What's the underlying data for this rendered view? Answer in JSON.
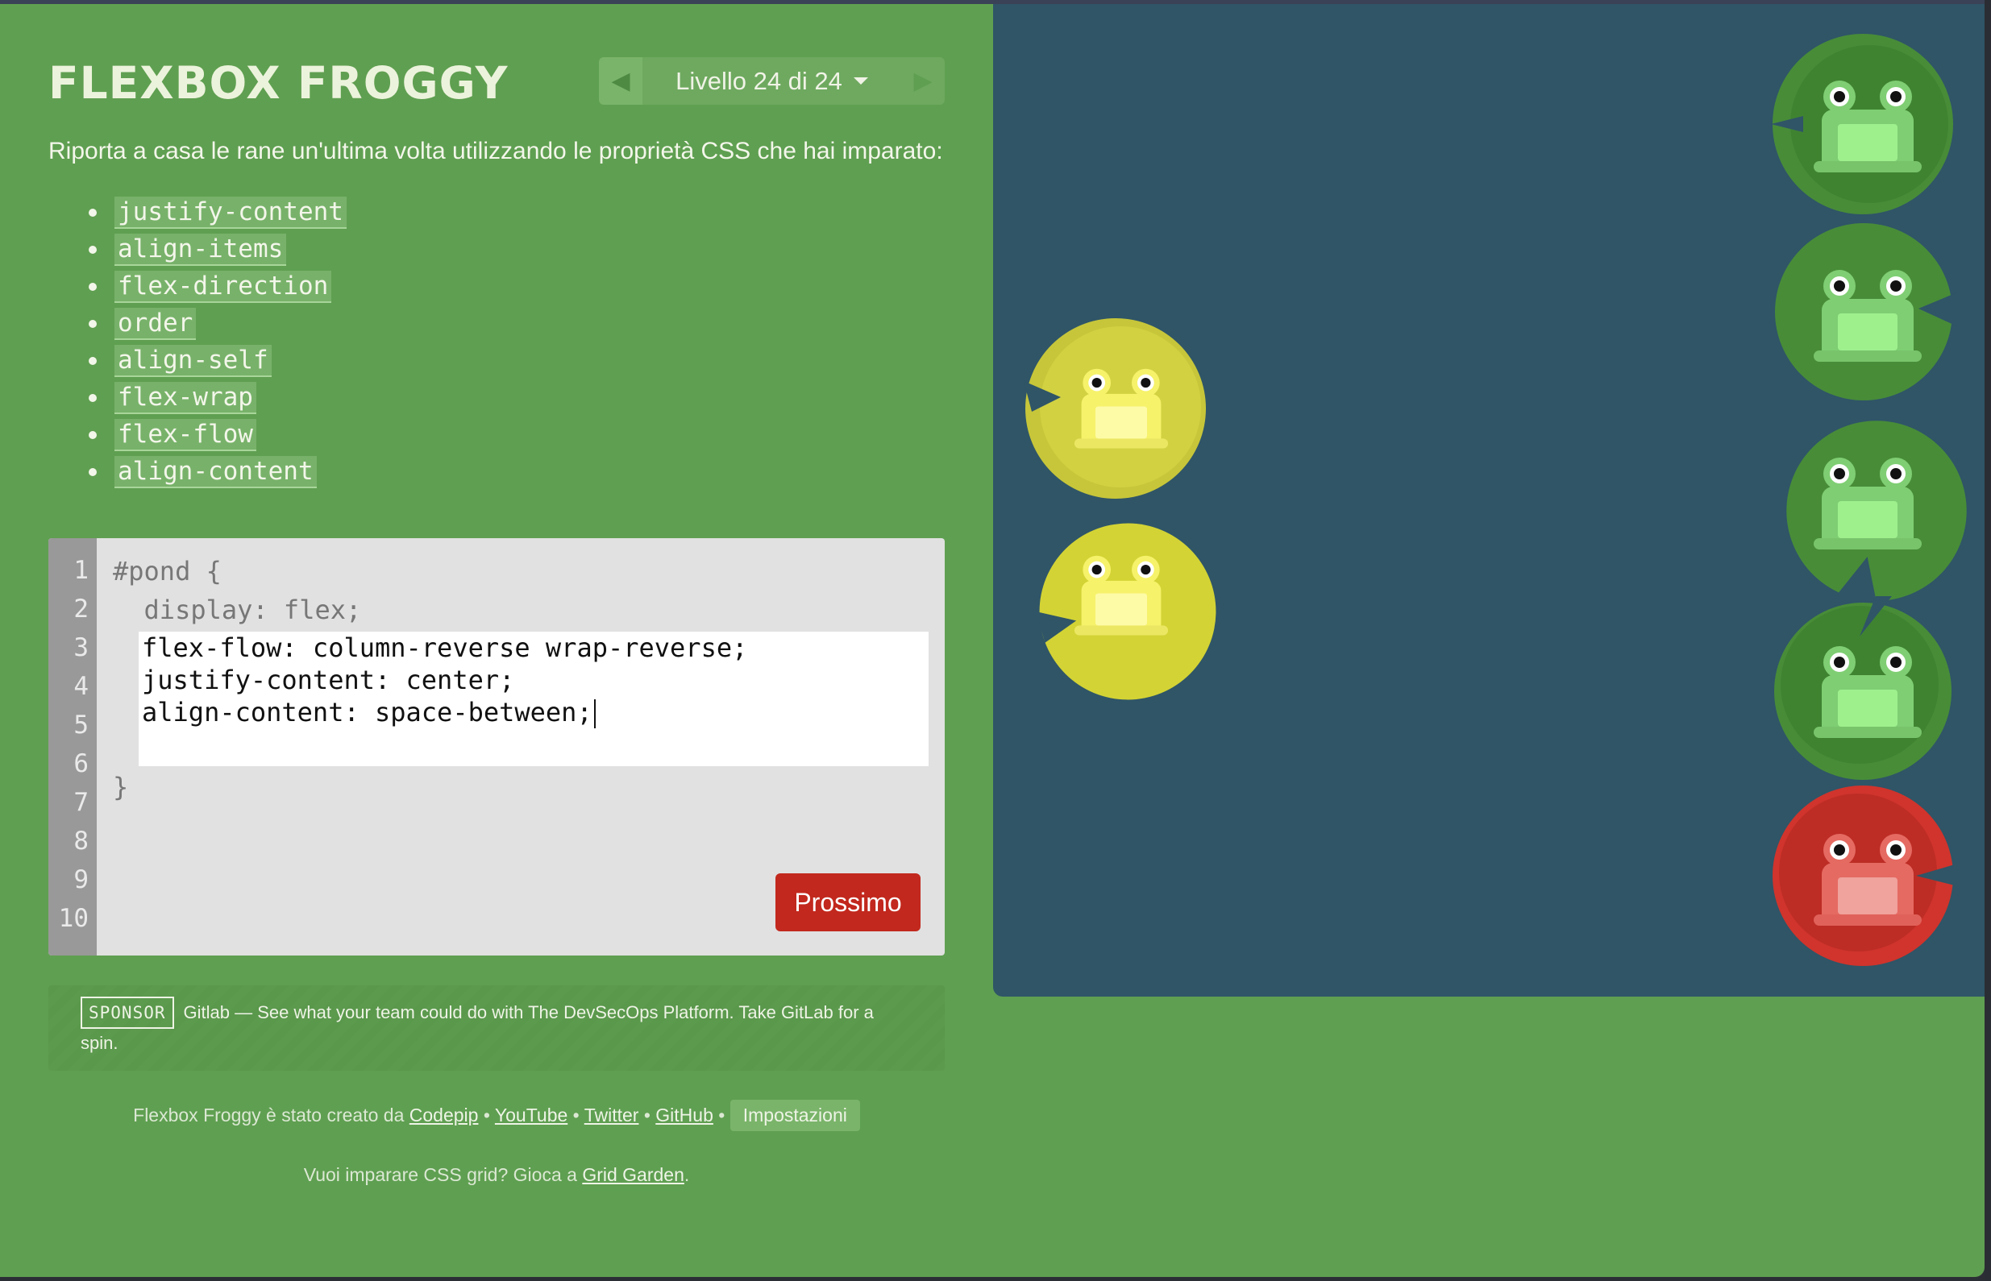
{
  "app": {
    "logo": "FLEXBOX FROGGY"
  },
  "level_nav": {
    "label": "Livello 24 di 24"
  },
  "instructions": "Riporta a casa le rane un'ultima volta utilizzando le proprietà CSS che hai imparato:",
  "properties": [
    "justify-content",
    "align-items",
    "flex-direction",
    "order",
    "align-self",
    "flex-wrap",
    "flex-flow",
    "align-content"
  ],
  "editor": {
    "line_numbers": [
      "1",
      "2",
      "3",
      "4",
      "5",
      "6",
      "7",
      "8",
      "9",
      "10"
    ],
    "line1": "#pond {",
    "line2": "  display: flex;",
    "input_lines": [
      "flex-flow: column-reverse wrap-reverse;",
      "justify-content: center;",
      "align-content: space-between;"
    ],
    "closing": "}",
    "next_button": "Prossimo"
  },
  "sponsor": {
    "badge": "SPONSOR",
    "text": "Gitlab — See what your team could do with The DevSecOps Platform. Take GitLab for a spin."
  },
  "footer": {
    "credit_prefix": "Flexbox Froggy è stato creato da",
    "links": [
      "Codepip",
      "YouTube",
      "Twitter",
      "GitHub"
    ],
    "separator": "•",
    "settings": "Impostazioni",
    "grid_prefix": "Vuoi imparare CSS grid? Gioca a",
    "grid_link": "Grid Garden",
    "grid_suffix": "."
  },
  "colors": {
    "background": "#5f9f51",
    "pond": "#2f5567",
    "green_pad": "#488c38",
    "yellow_pad": "#c7c63a",
    "red_pad": "#d0342c",
    "button": "#c2281d"
  },
  "pond": {
    "frogs": [
      "yellow",
      "yellow"
    ],
    "lilypads": [
      "green",
      "green",
      "green",
      "green",
      "red"
    ]
  }
}
